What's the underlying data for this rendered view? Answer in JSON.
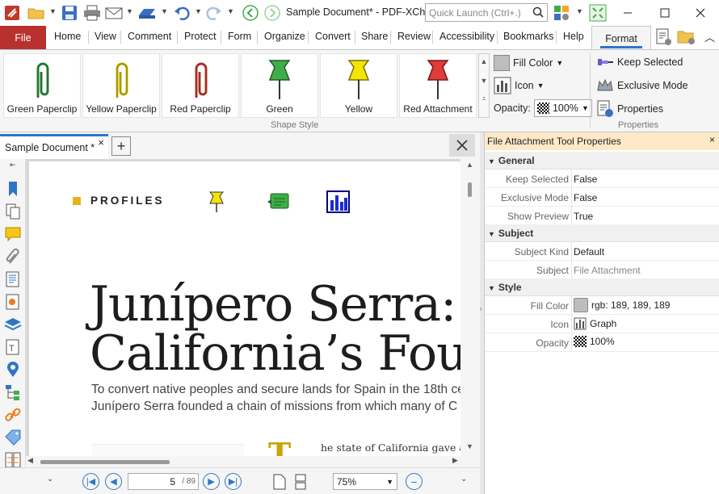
{
  "titlebar": {
    "title": "Sample Document* - PDF-XCh...",
    "quick_launch_placeholder": "Quick Launch (Ctrl+.)"
  },
  "ribbon_tabs": {
    "file": "File",
    "home": "Home",
    "view": "View",
    "comment": "Comment",
    "protect": "Protect",
    "form": "Form",
    "organize": "Organize",
    "convert": "Convert",
    "share": "Share",
    "review": "Review",
    "accessibility": "Accessibility",
    "bookmarks": "Bookmarks",
    "help": "Help",
    "format": "Format"
  },
  "ribbon": {
    "gallery": [
      {
        "label": "Green Paperclip",
        "color": "#2e8b3e"
      },
      {
        "label": "Yellow Paperclip",
        "color": "#c9b800"
      },
      {
        "label": "Red Paperclip",
        "color": "#c0392b"
      },
      {
        "label": "Green",
        "color": "#3fae49"
      },
      {
        "label": "Yellow",
        "color": "#f5e400"
      },
      {
        "label": "Red Attachment",
        "color": "#e03a3a"
      }
    ],
    "shape_style_group": "Shape Style",
    "fill_color": "Fill Color",
    "icon": "Icon",
    "opacity_label": "Opacity:",
    "opacity_value": "100%",
    "keep_selected": "Keep Selected",
    "exclusive_mode": "Exclusive Mode",
    "properties": "Properties",
    "properties_group": "Properties"
  },
  "document_tab": {
    "label": "Sample Document *"
  },
  "page": {
    "profiles_label": "PROFILES",
    "headline_line1": "Junípero Serra:",
    "headline_line2": "California’s Foundir",
    "subhead_line1": "To convert native peoples and secure lands for Spain in the 18th ce",
    "subhead_line2": "Junípero Serra founded a chain of missions from which many of C",
    "body_snippet": "he state of California gave a"
  },
  "statusbar": {
    "page_current": "5",
    "page_total": "/ 89",
    "zoom": "75%"
  },
  "properties_panel": {
    "title": "File Attachment Tool Properties",
    "sections": {
      "general": "General",
      "subject": "Subject",
      "style": "Style"
    },
    "rows": {
      "keep_selected": {
        "key": "Keep Selected",
        "value": "False"
      },
      "exclusive_mode": {
        "key": "Exclusive Mode",
        "value": "False"
      },
      "show_preview": {
        "key": "Show Preview",
        "value": "True"
      },
      "subject_kind": {
        "key": "Subject Kind",
        "value": "Default"
      },
      "subject": {
        "key": "Subject",
        "value": "File Attachment"
      },
      "fill_color": {
        "key": "Fill Color",
        "value": "rgb: 189, 189, 189"
      },
      "icon": {
        "key": "Icon",
        "value": "Graph"
      },
      "opacity": {
        "key": "Opacity",
        "value": "100%"
      }
    }
  },
  "colors": {
    "accent": "#2f76c7",
    "file_tab": "#b8312f",
    "panel_header": "#fde9c8",
    "fill_swatch": "#bdbdbd"
  }
}
